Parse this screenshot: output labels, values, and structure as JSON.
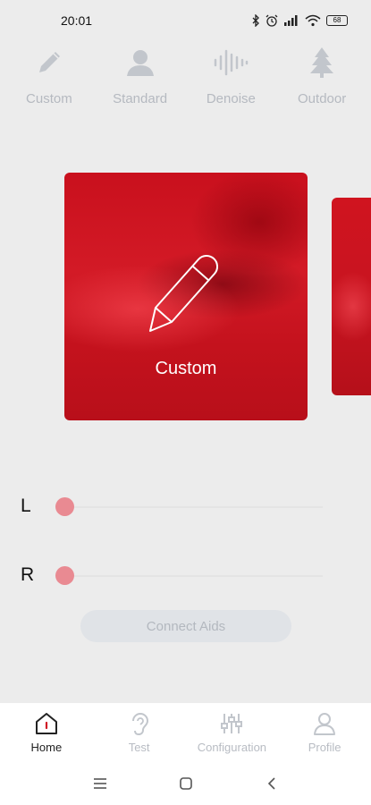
{
  "status_bar": {
    "time": "20:01",
    "battery": "68"
  },
  "mode_tabs": [
    {
      "label": "Custom",
      "icon": "pencil-icon"
    },
    {
      "label": "Standard",
      "icon": "person-icon"
    },
    {
      "label": "Denoise",
      "icon": "waveform-icon"
    },
    {
      "label": "Outdoor",
      "icon": "tree-icon"
    }
  ],
  "carousel": {
    "active_card": {
      "label": "Custom",
      "icon": "pencil-icon"
    }
  },
  "ears": {
    "left": {
      "label": "L",
      "level": 0
    },
    "right": {
      "label": "R",
      "level": 0
    }
  },
  "connect_button": {
    "label": "Connect Aids"
  },
  "bottom_nav": [
    {
      "label": "Home",
      "icon": "home-icon",
      "active": true
    },
    {
      "label": "Test",
      "icon": "ear-icon",
      "active": false
    },
    {
      "label": "Configuration",
      "icon": "sliders-icon",
      "active": false
    },
    {
      "label": "Profile",
      "icon": "user-icon",
      "active": false
    }
  ],
  "colors": {
    "accent": "#d01a25",
    "thumb": "#e98a92",
    "inactive": "#b8bcc3",
    "background": "#ececec"
  }
}
